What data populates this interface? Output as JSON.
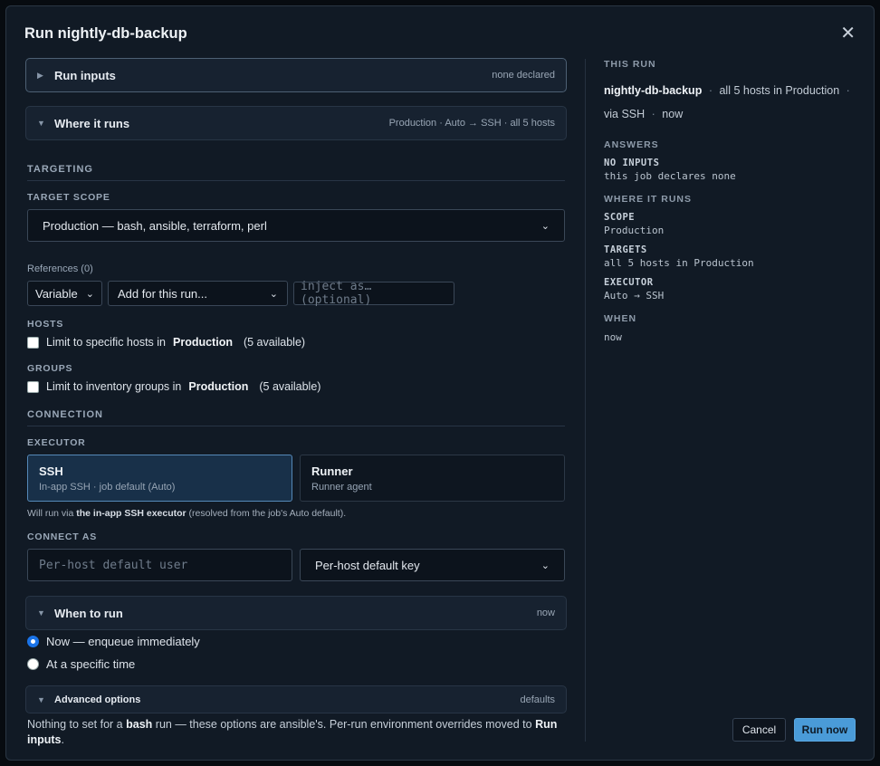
{
  "dialog": {
    "title": "Run nightly-db-backup",
    "close_glyph": "✕"
  },
  "sections": {
    "run_inputs": {
      "caret": "▶",
      "title": "Run inputs",
      "summary": "none declared"
    },
    "where_it_runs": {
      "caret": "▼",
      "title": "Where it runs",
      "summary": "Production · Auto → SSH · all 5 hosts"
    },
    "when_to_run": {
      "caret": "▼",
      "title": "When to run",
      "summary": "now"
    },
    "advanced": {
      "caret": "▼",
      "title": "Advanced options",
      "summary": "defaults"
    }
  },
  "targeting": {
    "heading": "TARGETING",
    "scope_label": "TARGET SCOPE",
    "scope_value": "Production — bash, ansible, terraform, perl",
    "references_label": "References (0)",
    "ref_type": "Variable",
    "ref_add": "Add for this run...",
    "inject_placeholder": "inject as… (optional)",
    "hosts_label": "HOSTS",
    "hosts_prefix": "Limit to specific hosts in",
    "hosts_env": "Production",
    "hosts_count": "(5 available)",
    "groups_label": "GROUPS",
    "groups_prefix": "Limit to inventory groups in",
    "groups_env": "Production",
    "groups_count": "(5 available)"
  },
  "connection": {
    "heading": "CONNECTION",
    "executor_label": "EXECUTOR",
    "executors": [
      {
        "name": "SSH",
        "desc": "In-app SSH · job default (Auto)",
        "selected": true
      },
      {
        "name": "Runner",
        "desc": "Runner agent",
        "selected": false
      }
    ],
    "note_prefix": "Will run via",
    "note_bold": "the in-app SSH executor",
    "note_suffix": "(resolved from the job's Auto default).",
    "connect_as_label": "CONNECT AS",
    "user_placeholder": "Per-host default user",
    "key_value": "Per-host default key"
  },
  "when": {
    "options": [
      {
        "label": "Now — enqueue immediately",
        "selected": true
      },
      {
        "label": "At a specific time",
        "selected": false
      }
    ]
  },
  "advanced_note": {
    "t1": "Nothing to set for a",
    "b1": "bash",
    "t2": "run — these options are ansible's. Per-run environment overrides moved to",
    "b2": "Run inputs",
    "t3": "."
  },
  "summary_panel": {
    "this_run_title": "THIS RUN",
    "job": "nightly-db-backup",
    "hosts": "all 5 hosts in Production",
    "via": "via SSH",
    "when": "now",
    "sep": "·",
    "answers_title": "ANSWERS",
    "no_inputs_key": "NO INPUTS",
    "no_inputs_val": "this job declares none",
    "where_title": "WHERE IT RUNS",
    "scope_key": "SCOPE",
    "scope_val": "Production",
    "targets_key": "TARGETS",
    "targets_val": "all 5 hosts in Production",
    "executor_key": "EXECUTOR",
    "executor_val": "Auto → SSH",
    "when_key": "WHEN",
    "when_val": "now"
  },
  "buttons": {
    "cancel": "Cancel",
    "run": "Run now"
  },
  "colors": {
    "primary": "#4a9bd8",
    "selected_card": "#183049",
    "background": "#111a25"
  }
}
